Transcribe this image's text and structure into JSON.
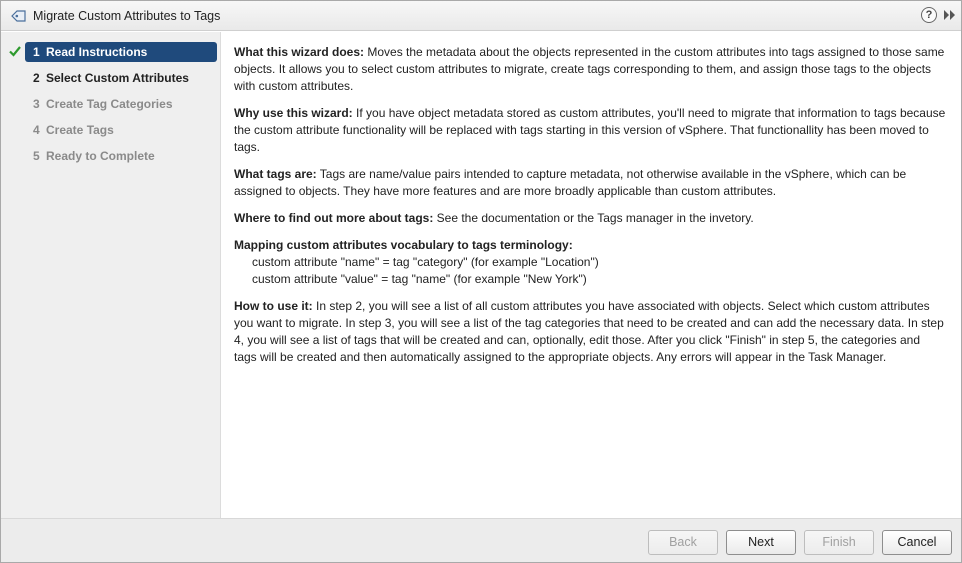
{
  "window": {
    "title": "Migrate Custom Attributes to Tags",
    "title_icon": "tag-icon",
    "help_label": "?",
    "help_icon": "help-icon",
    "expand_icon": "double-chevron-right-icon"
  },
  "steps": [
    {
      "num": "1",
      "label": "Read Instructions",
      "state": "active",
      "completed": true
    },
    {
      "num": "2",
      "label": "Select Custom Attributes",
      "state": "enabled",
      "completed": false
    },
    {
      "num": "3",
      "label": "Create Tag Categories",
      "state": "disabled",
      "completed": false
    },
    {
      "num": "4",
      "label": "Create Tags",
      "state": "disabled",
      "completed": false
    },
    {
      "num": "5",
      "label": "Ready to Complete",
      "state": "disabled",
      "completed": false
    }
  ],
  "content": {
    "what_head": "What this wizard does:",
    "what_body": " Moves the metadata about the objects represented in the custom attributes into tags assigned to those same objects. It allows you to select custom attributes to migrate, create tags corresponding to them, and assign those tags to the objects with custom attributes.",
    "why_head": "Why use this wizard:",
    "why_body": " If you have object metadata stored as custom attributes, you'll need to migrate that information to tags because the custom attribute functionality will be replaced with tags starting in this version of vSphere. That functionallity has been moved to tags.",
    "tags_head": "What tags are:",
    "tags_body": " Tags are name/value pairs intended to capture metadata, not otherwise available in the vSphere, which can be assigned to objects. They have more features and are more broadly applicable than custom attributes.",
    "where_head": "Where to find out more about tags:",
    "where_body": " See the documentation or the Tags manager in the invetory.",
    "mapping_head": "Mapping custom attributes vocabulary to tags terminology:",
    "mapping_line1": "custom attribute \"name\" = tag \"category\" (for example \"Location\")",
    "mapping_line2": "custom attribute \"value\" = tag \"name\" (for example \"New York\")",
    "how_head": "How to use it:",
    "how_body": " In step 2, you will see a list of all custom attributes you have associated with objects. Select which custom attributes you want to migrate. In step 3, you will see a list of the tag categories that need to be created and can add the necessary data. In step 4, you will see a list of tags that will be created and can, optionally, edit those. After you click \"Finish\" in step 5, the categories and tags will be created and then automatically assigned to the appropriate objects. Any errors will appear in the Task Manager."
  },
  "footer": {
    "back_label": "Back",
    "next_label": "Next",
    "finish_label": "Finish",
    "cancel_label": "Cancel"
  },
  "colors": {
    "active_step_bg": "#1f4a7c",
    "check_green": "#2e9a2e",
    "disabled_text": "#8a8a8a"
  }
}
